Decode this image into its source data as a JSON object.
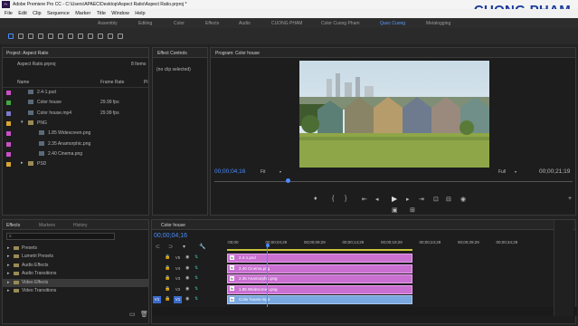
{
  "app_title": "Adobe Premiere Pro CC - C:\\Users\\APAEC\\Desktop\\Aspect Ratio\\Aspect Ratio.prproj *",
  "watermark": "CUONG PHAM",
  "menu": [
    "File",
    "Edit",
    "Clip",
    "Sequence",
    "Marker",
    "Title",
    "Window",
    "Help"
  ],
  "workspaces": [
    "Assembly",
    "Editing",
    "Color",
    "Effects",
    "Audio",
    "CUONG PHAM",
    "Color Cuong Pham",
    "Quoc Cuong",
    "Metalogging"
  ],
  "project": {
    "title": "Project: Aspect Ratio",
    "file": "Aspect Ratio.prproj",
    "count": "8 Items",
    "col_name": "Name",
    "col_rate": "Frame Rate",
    "col_more": "Pi",
    "items": [
      {
        "name": "2.4-1.psd",
        "rate": "",
        "color": "#c84fc6",
        "indent": 0
      },
      {
        "name": "Color house",
        "rate": "29.99 fps",
        "color": "#3fa83f",
        "indent": 0
      },
      {
        "name": "Color house.mp4",
        "rate": "29.99 fps",
        "color": "#7a7acb",
        "indent": 0
      },
      {
        "name": "PNG",
        "rate": "",
        "color": "#d9a531",
        "indent": 0
      },
      {
        "name": "1.85 Widescreen.png",
        "rate": "",
        "color": "#c84fc6",
        "indent": 1
      },
      {
        "name": "2.35 Anamorphic.png",
        "rate": "",
        "color": "#c84fc6",
        "indent": 1
      },
      {
        "name": "2.40 Cinema.png",
        "rate": "",
        "color": "#c84fc6",
        "indent": 1
      },
      {
        "name": "PSD",
        "rate": "",
        "color": "#d9a531",
        "indent": 0
      }
    ]
  },
  "effect_controls": {
    "title": "Effect Controls",
    "empty": "(no clip selected)"
  },
  "program": {
    "title": "Program: Color house",
    "timecode": "00;00;04;16",
    "fit": "Fit",
    "quality": "Full",
    "duration": "00;00;21;19"
  },
  "effects_panel": {
    "tabs": [
      "Effects",
      "Markers",
      "History"
    ],
    "items": [
      "Presets",
      "Lumetri Presets",
      "Audio Effects",
      "Audio Transitions",
      "Video Effects",
      "Video Transitions"
    ],
    "highlighted": "Video Effects"
  },
  "timeline": {
    "tab": "Color house",
    "timecode": "00;00;04;16",
    "ruler": [
      ":00;00",
      "00;00;04;29",
      "00;00;09;29",
      "00;00;14;29",
      "00;00;19;29",
      "00;00;24;29",
      "00;00;29;29",
      "00;00;34;28"
    ],
    "tracks": [
      "V5",
      "V4",
      "V3",
      "V2",
      "V1"
    ],
    "clips": [
      "2.4-1.psd",
      "2.40 Cinema.png",
      "2.35 Anamorphic.png",
      "1.85 Widescreen.png",
      "Color house.mp4"
    ],
    "source_patch": "V1"
  },
  "colors": {
    "accent": "#4a8cff",
    "pink_clip": "#c970d1",
    "blue_clip": "#7aa8e0"
  }
}
